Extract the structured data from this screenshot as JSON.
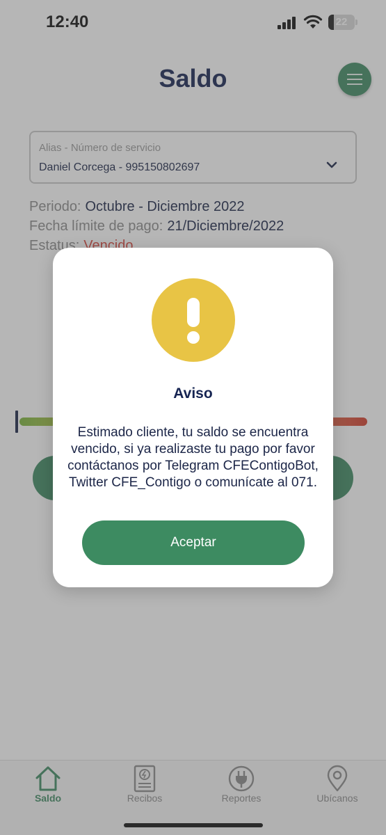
{
  "status_bar": {
    "time": "12:40",
    "battery": "22",
    "battery_level": 0.22
  },
  "header": {
    "title": "Saldo"
  },
  "service_selector": {
    "label": "Alias - Número de servicio",
    "value": "Daniel Corcega - 995150802697"
  },
  "billing": {
    "period_label": "Periodo:",
    "period_value": "Octubre - Diciembre 2022",
    "due_label": "Fecha límite de pago:",
    "due_value": "21/Diciembre/2022",
    "status_label": "Estatus:",
    "status_value": "Vencido"
  },
  "dialog": {
    "title": "Aviso",
    "message": "Estimado cliente, tu saldo se encuentra vencido, si ya realizaste tu pago por favor contáctanos por Telegram CFEContigoBot, Twitter CFE_Contigo o comunícate al 071.",
    "accept_label": "Aceptar"
  },
  "tabs": [
    {
      "label": "Saldo",
      "icon": "home-icon",
      "active": true
    },
    {
      "label": "Recibos",
      "icon": "receipt-icon",
      "active": false
    },
    {
      "label": "Reportes",
      "icon": "plug-icon",
      "active": false
    },
    {
      "label": "Ubícanos",
      "icon": "location-pin-icon",
      "active": false
    }
  ],
  "colors": {
    "brand_green": "#3f8a62",
    "title_navy": "#162452",
    "warning_yellow": "#e8c445",
    "status_red": "#d5463d"
  }
}
